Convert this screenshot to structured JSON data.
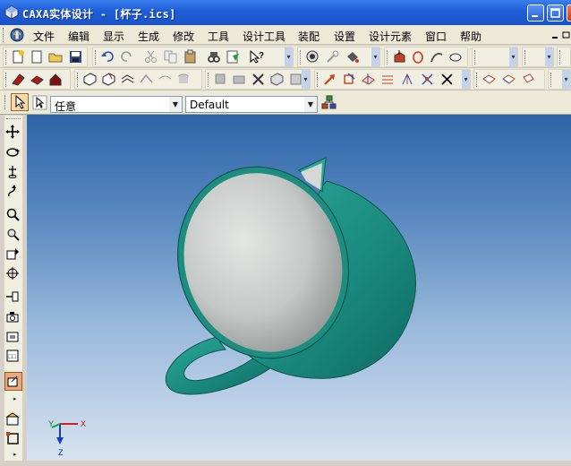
{
  "window": {
    "title": "CAXA实体设计 - [杯子.ics]",
    "buttons": [
      "minimize",
      "maximize",
      "close"
    ]
  },
  "menu": {
    "items": [
      "文件",
      "编辑",
      "显示",
      "生成",
      "修改",
      "工具",
      "设计工具",
      "装配",
      "设置",
      "设计元素",
      "窗口",
      "帮助"
    ]
  },
  "selection_bar": {
    "filter_value": "任意",
    "style_value": "Default"
  },
  "viewport": {
    "background_top": "#2e64a8",
    "background_bottom": "#d8e4f0",
    "model_color": "#1f8c80",
    "model_interior": "#c8ccc8",
    "axes": {
      "x": "X",
      "y": "Y",
      "z": "Z"
    }
  },
  "colors": {
    "titlebar": "#1f5fd8",
    "chrome": "#ece9d8"
  }
}
